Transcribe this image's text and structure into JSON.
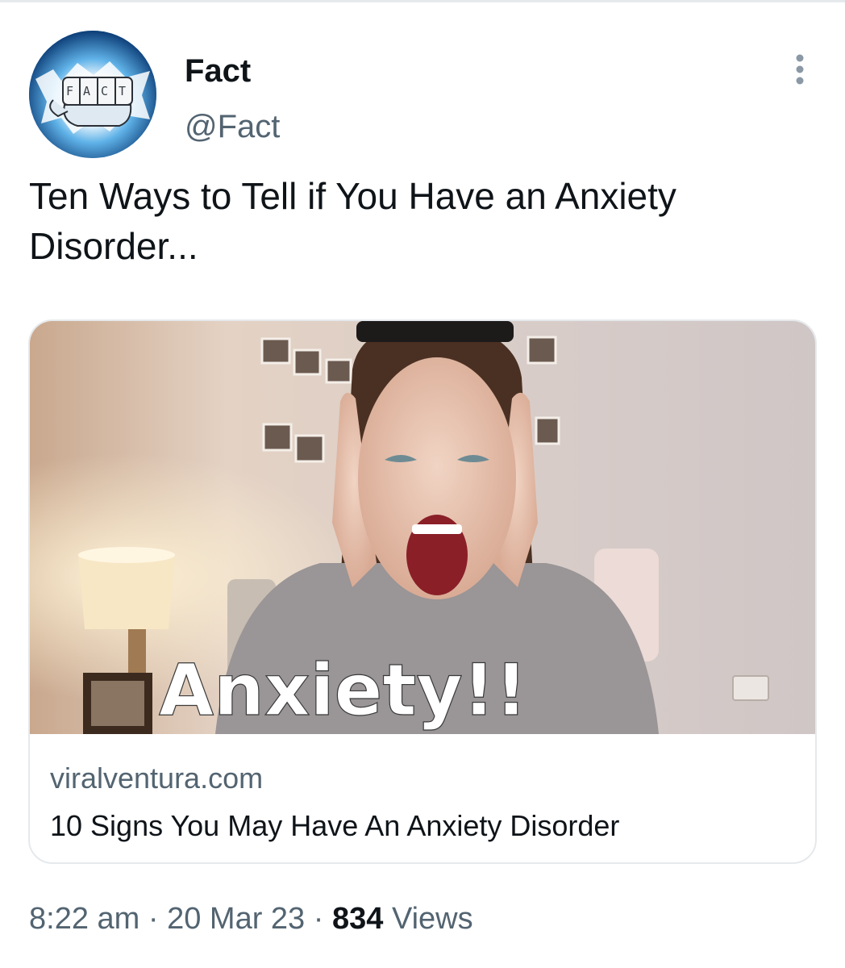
{
  "tweet": {
    "author": {
      "display_name": "Fact",
      "handle": "@Fact",
      "avatar_text": "FACT"
    },
    "text": "Ten Ways to Tell if You Have an Anxiety Disorder...",
    "more_icon": "more-vertical-icon",
    "card": {
      "image_overlay_text": "Anxiety!!",
      "domain": "viralventura.com",
      "title": "10 Signs You May Have An Anxiety Disorder"
    },
    "meta": {
      "time": "8:22 am",
      "separator": "·",
      "date": "20 Mar 23",
      "views_count": "834",
      "views_label": "Views"
    }
  },
  "colors": {
    "primary_text": "#0f1419",
    "secondary_text": "#536471",
    "border": "#e6e9ec"
  }
}
